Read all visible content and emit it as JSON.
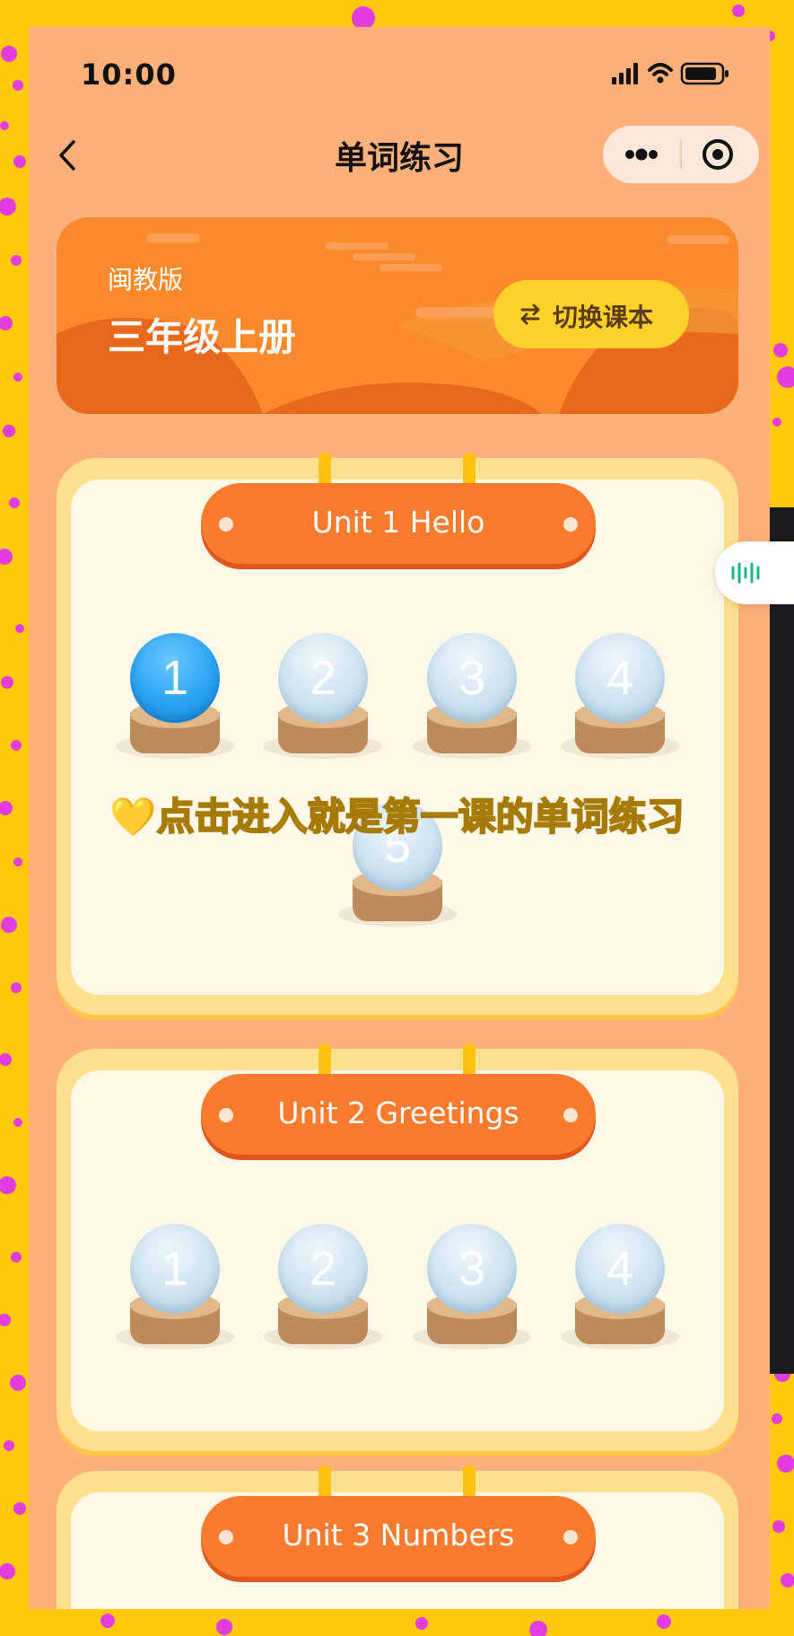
{
  "status_bar": {
    "time": "10:00"
  },
  "nav": {
    "title": "单词练习"
  },
  "banner": {
    "edition": "闽教版",
    "book": "三年级上册",
    "switch_label": "切换课本"
  },
  "units": [
    {
      "title": "Unit 1 Hello",
      "lessons": [
        "1",
        "2",
        "3",
        "4",
        "5"
      ],
      "active_lesson": "1"
    },
    {
      "title": "Unit 2 Greetings",
      "lessons": [
        "1",
        "2",
        "3",
        "4"
      ]
    },
    {
      "title": "Unit 3 Numbers"
    }
  ],
  "overlay": {
    "heart": "💛",
    "caption": "点击进入就是第一课的单词练习"
  },
  "colors": {
    "page_bg": "#FDB07A",
    "accent_orange": "#FA7B2D",
    "banner_orange": "#FA8A2C",
    "yellow": "#FFD22B",
    "active_blue": "#2AA4F4",
    "border_yellow": "#FFC90B"
  },
  "icons": {
    "back": "chevron-left-icon",
    "more": "more-dots-icon",
    "target": "target-icon",
    "switch": "swap-icon",
    "float": "audio-wave-icon"
  }
}
